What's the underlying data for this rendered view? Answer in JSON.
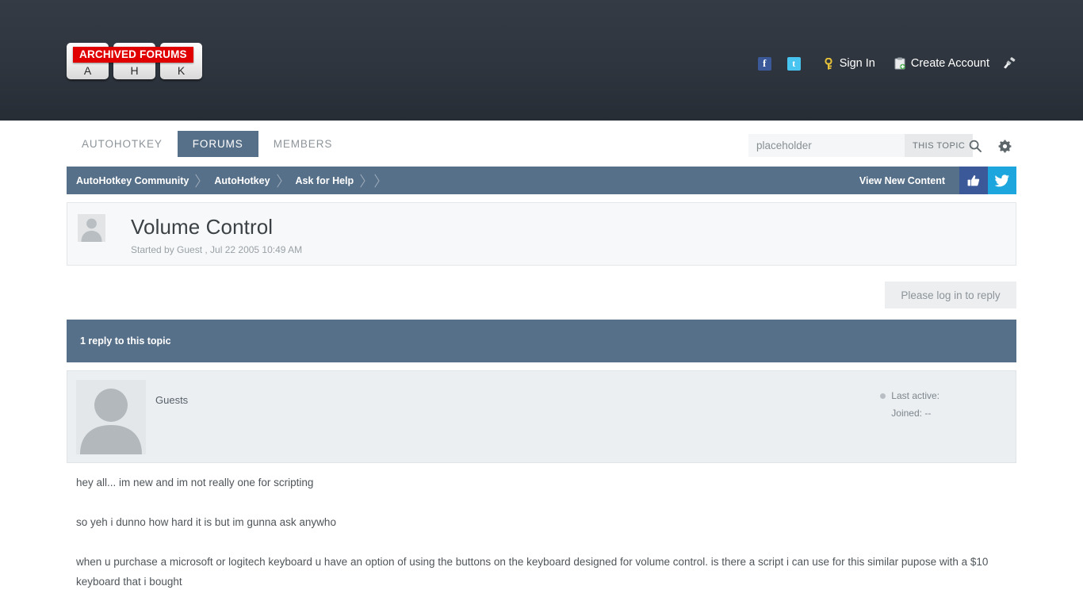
{
  "header": {
    "logo": {
      "banner_text": "ARCHIVED FORUMS",
      "keys": [
        "A",
        "H",
        "K"
      ]
    },
    "user_links": {
      "facebook_icon": "facebook-icon",
      "twitter_icon": "twitter-icon",
      "sign_in": "Sign In",
      "create_account": "Create Account",
      "theme_icon": "paintbrush-icon"
    }
  },
  "nav": {
    "tabs": [
      {
        "label": "AUTOHOTKEY",
        "active": false
      },
      {
        "label": "FORUMS",
        "active": true
      },
      {
        "label": "MEMBERS",
        "active": false
      }
    ]
  },
  "search": {
    "value": "",
    "placeholder": "placeholder",
    "scope_label": "THIS TOPIC",
    "search_icon": "search-icon",
    "options_icon": "gear-icon"
  },
  "breadcrumb": {
    "items": [
      "AutoHotkey Community",
      "AutoHotkey",
      "Ask for Help"
    ],
    "view_new_content": "View New Content",
    "facebook_like_icon": "thumbs-up-icon",
    "twitter_share_icon": "twitter-bird-icon"
  },
  "topic": {
    "title": "Volume Control",
    "started_by": "Started by Guest , Jul 22 2005 10:49 AM",
    "reply_button": "Please log in to reply",
    "reply_count_text": "1 reply to this topic"
  },
  "post": {
    "author": "Guests",
    "last_active_label": "Last active:",
    "joined_label": "Joined: --",
    "paragraphs": [
      "hey all... im new and im not really one for scripting",
      "so yeh i dunno how hard it is but im gunna ask anywho",
      "when u purchase a microsoft or logitech keyboard u have an option of using the buttons on the keyboard designed for volume control. is there a script i can use for this similar pupose with a $10 keyboard that i bought"
    ]
  },
  "colors": {
    "header_dark": "#2f353e",
    "accent_slate": "#577089",
    "banner_red": "#e00000",
    "facebook_blue": "#3b5998",
    "twitter_blue": "#1da6dd"
  }
}
